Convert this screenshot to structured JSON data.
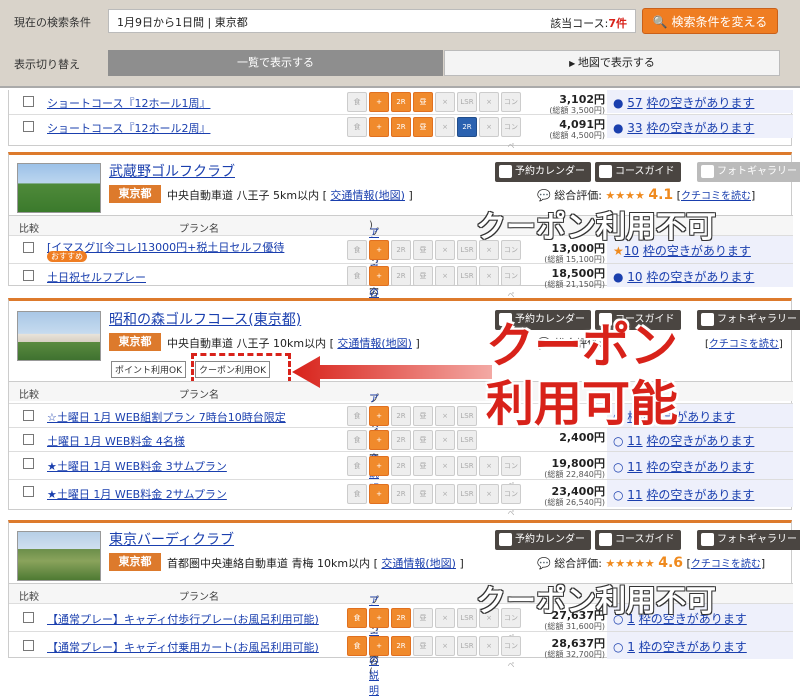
{
  "search": {
    "label": "現在の検索条件",
    "condition": "1月9日から1日間 | 東京都",
    "count_label": "該当コース:",
    "count_value": "7件",
    "change_button": "検索条件を変える"
  },
  "switcher": {
    "label": "表示切り替え",
    "list_view": "一覧で表示する",
    "map_view": "地図で表示する"
  },
  "top_rows": [
    {
      "plan": "ショートコース『12ホール1周』",
      "price": "3,102円",
      "price_sub": "(総額 3,500円)",
      "avail_num": "57",
      "avail_text": "枠の空きがあります"
    },
    {
      "plan": "ショートコース『12ホール2周』",
      "price": "4,091円",
      "price_sub": "(総額 4,500円)",
      "avail_num": "33",
      "avail_text": "枠の空きがあります"
    }
  ],
  "common": {
    "calendar_btn": "予約カレンダー",
    "guide_btn": "コースガイド",
    "photo_btn": "フォトギャラリー",
    "col_compare": "比較",
    "col_plan": "プラン名",
    "col_content": "プラン内容(",
    "col_icon_link": "アイコンの説明",
    "rating_label": "総合評価:",
    "kuchikomi": "クチコミを読む",
    "traffic": "交通情報(地図)"
  },
  "courses": [
    {
      "name": "武蔵野ゴルフクラブ",
      "area": "東京都",
      "road": "中央自動車道 八王子 5km以内",
      "stars": "★★★★",
      "score": "4.1",
      "rows": [
        {
          "plan": "[イマスグ][今コレ]13000円+税土日セルフ優待",
          "badge": "おすすめ",
          "price": "13,000円",
          "price_sub": "(総額 15,100円)",
          "avail_num": "10",
          "avail_text": "枠の空きがあります"
        },
        {
          "plan": "土日祝セルフプレー",
          "price": "18,500円",
          "price_sub": "(総額 21,150円)",
          "avail_num": "10",
          "avail_text": "枠の空きがあります"
        }
      ]
    },
    {
      "name": "昭和の森ゴルフコース(東京都)",
      "area": "東京都",
      "road": "中央自動車道 八王子 10km以内",
      "point_tag": "ポイント利用OK",
      "coupon_tag": "クーポン利用OK",
      "rows": [
        {
          "plan": "☆土曜日 1月 WEB組割プラン 7時台10時台限定",
          "price": "",
          "price_sub": "",
          "avail_num": "",
          "avail_text": "枠の空きがあります"
        },
        {
          "plan": "土曜日 1月 WEB料金 4名様",
          "price": "2,400円",
          "price_sub": "",
          "avail_num": "11",
          "avail_text": "枠の空きがあります"
        },
        {
          "plan": "★土曜日 1月 WEB料金 3サムプラン",
          "price": "19,800円",
          "price_sub": "(総額 22,840円)",
          "avail_num": "11",
          "avail_text": "枠の空きがあります"
        },
        {
          "plan": "★土曜日 1月 WEB料金 2サムプラン",
          "price": "23,400円",
          "price_sub": "(総額 26,540円)",
          "avail_num": "11",
          "avail_text": "枠の空きがあります"
        }
      ]
    },
    {
      "name": "東京バーディクラブ",
      "area": "東京都",
      "road": "首都圏中央連絡自動車道 青梅 10km以内",
      "stars": "★★★★★",
      "score": "4.6",
      "rows": [
        {
          "plan": "【通常プレー】キャディ付歩行プレー(お風呂利用可能)",
          "price": "27,637円",
          "price_sub": "(総額 31,600円)",
          "avail_num": "1",
          "avail_text": "枠の空きがあります"
        },
        {
          "plan": "【通常プレー】キャディ付乗用カート(お風呂利用可能)",
          "price": "28,637円",
          "price_sub": "(総額 32,700円)",
          "avail_num": "1",
          "avail_text": "枠の空きがあります"
        }
      ]
    }
  ],
  "icon_labels": {
    "meal": "食",
    "plus": "+",
    "cart": "2R",
    "lunch": "昼",
    "x": "×",
    "lsr": "LSR",
    "conpe": "コンペ",
    "play2r": "2R PLAY"
  },
  "annotations": {
    "coupon_no_1": "クーポン利用不可",
    "coupon_yes_line1": "クーポン",
    "coupon_yes_line2": "利用可能",
    "coupon_no_2": "クーポン利用不可"
  },
  "colors": {
    "accent": "#dd7a2c",
    "button": "#ef7d22",
    "link": "#1a3fae",
    "annotation_red": "#d8221a"
  }
}
